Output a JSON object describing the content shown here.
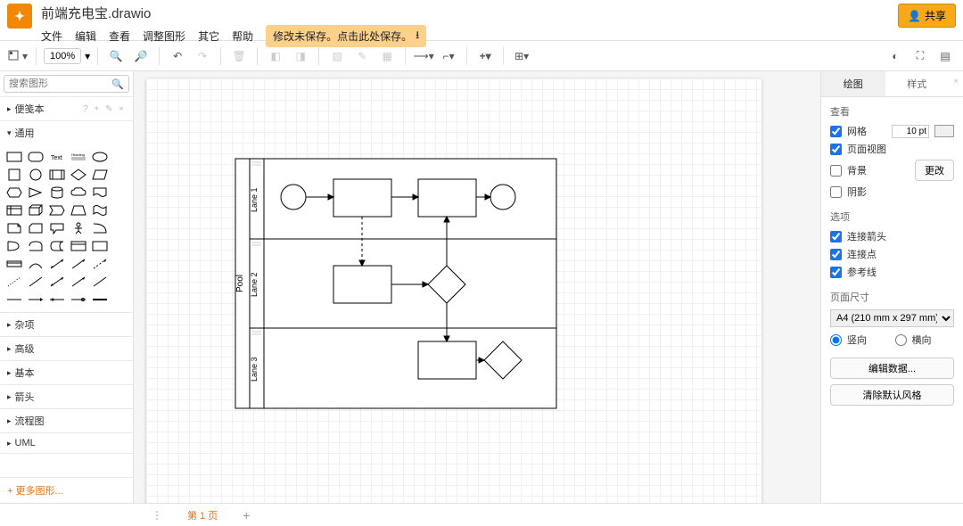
{
  "filename": "前端充电宝.drawio",
  "menu": {
    "file": "文件",
    "edit": "编辑",
    "view": "查看",
    "arrange": "调整图形",
    "extras": "其它",
    "help": "帮助"
  },
  "saveHint": "修改未保存。点击此处保存。",
  "share": "共享",
  "zoom": "100%",
  "searchPlaceholder": "搜索图形",
  "sections": {
    "scratchpad": "便笺本",
    "general": "通用",
    "misc": "杂项",
    "advanced": "高级",
    "basic": "基本",
    "arrows": "箭头",
    "flowchart": "流程图",
    "uml": "UML"
  },
  "moreShapes": "+ 更多图形...",
  "page1": "第 1 页",
  "pool": {
    "title": "Pool",
    "lane1": "Lane 1",
    "lane2": "Lane 2",
    "lane3": "Lane 3"
  },
  "rightPanel": {
    "drawTab": "绘图",
    "styleTab": "样式",
    "view": "查看",
    "grid": "网格",
    "gridSize": "10 pt",
    "pageView": "页面视图",
    "background": "背景",
    "shadow": "阴影",
    "change": "更改",
    "options": "选项",
    "arrows": "连接箭头",
    "points": "连接点",
    "guides": "参考线",
    "pageSize": "页面尺寸",
    "a4": "A4 (210 mm x 297 mm)",
    "portrait": "竖向",
    "landscape": "横向",
    "editData": "编辑数据...",
    "clearStyle": "清除默认风格"
  }
}
